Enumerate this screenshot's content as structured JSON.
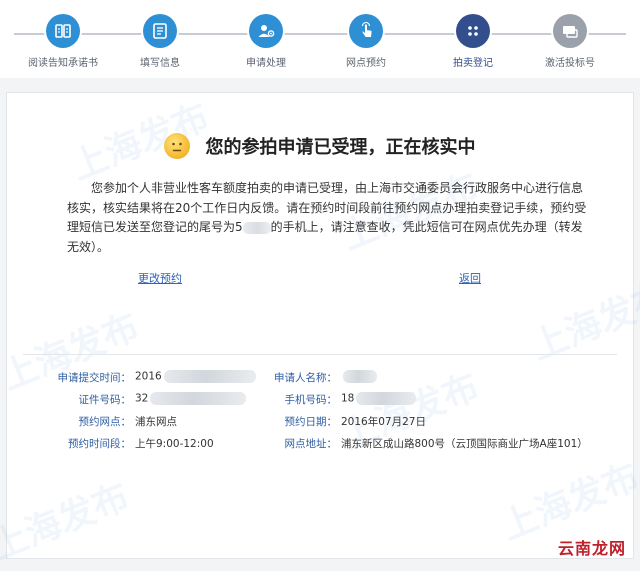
{
  "steps": [
    {
      "label": "阅读告知承诺书",
      "icon": "book-icon",
      "state": "done"
    },
    {
      "label": "填写信息",
      "icon": "form-icon",
      "state": "done"
    },
    {
      "label": "申请处理",
      "icon": "settings-user-icon",
      "state": "done"
    },
    {
      "label": "网点预约",
      "icon": "tap-hand-icon",
      "state": "done"
    },
    {
      "label": "拍卖登记",
      "icon": "dots-icon",
      "state": "current"
    },
    {
      "label": "激活投标号",
      "icon": "card-icon",
      "state": "todo"
    }
  ],
  "notice": {
    "title": "您的参拍申请已受理，正在核实中",
    "body_part1": "您参加个人非营业性客车额度拍卖的申请已受理，由上海市交通委员会行政服务中心进行信息核实，核实结果将在20个工作日内反馈。请在预约时间段前往预约网点办理拍卖登记手续，预约受理短信已发送至您登记的尾号为5",
    "body_part2": "的手机上，请注意查收，凭此短信可在网点优先办理（转发无效）。"
  },
  "links": {
    "modify": "更改预约",
    "back": "返回"
  },
  "info": {
    "submit_time_label": "申请提交时间：",
    "submit_time_value": "2016",
    "applicant_label": "申请人名称：",
    "applicant_value": "",
    "id_label": "证件号码：",
    "id_value": "32",
    "phone_label": "手机号码：",
    "phone_value": "18",
    "outlet_label": "预约网点：",
    "outlet_value": "浦东网点",
    "date_label": "预约日期：",
    "date_value": "2016年07月27日",
    "slot_label": "预约时间段：",
    "slot_value": "上午9:00-12:00",
    "address_label": "网点地址：",
    "address_value": "浦东新区成山路800号（云顶国际商业广场A座101）"
  },
  "watermark": "上海发布",
  "source_logo": "云南龙网",
  "colors": {
    "step_done": "#2f8fd4",
    "step_current": "#334e8c",
    "step_todo": "#9aa1aa",
    "link": "#2a64b8",
    "label": "#2f5fa3"
  }
}
